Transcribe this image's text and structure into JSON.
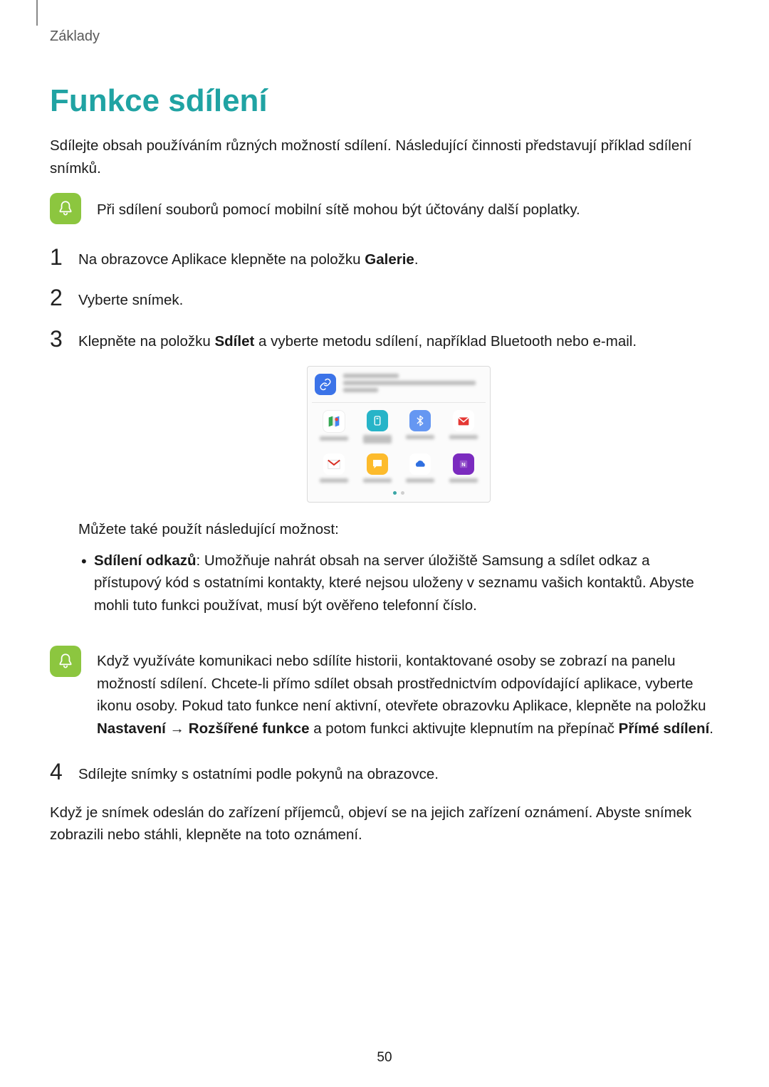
{
  "chapter": "Základy",
  "title": "Funkce sdílení",
  "intro": "Sdílejte obsah používáním různých možností sdílení. Následující činnosti představují příklad sdílení snímků.",
  "note1": "Při sdílení souborů pomocí mobilní sítě mohou být účtovány další poplatky.",
  "steps": {
    "s1_pre": "Na obrazovce Aplikace klepněte na položku ",
    "s1_bold": "Galerie",
    "s1_post": ".",
    "s2": "Vyberte snímek.",
    "s3_pre": "Klepněte na položku ",
    "s3_bold": "Sdílet",
    "s3_post": " a vyberte metodu sdílení, například Bluetooth nebo e-mail.",
    "s4": "Sdílejte snímky s ostatními podle pokynů na obrazovce."
  },
  "also_use": "Můžete také použít následující možnost:",
  "bullet": {
    "bold": "Sdílení odkazů",
    "text": ": Umožňuje nahrát obsah na server úložiště Samsung a sdílet odkaz a přístupový kód s ostatními kontakty, které nejsou uloženy v seznamu vašich kontaktů. Abyste mohli tuto funkci používat, musí být ověřeno telefonní číslo."
  },
  "note2": {
    "p1": "Když využíváte komunikaci nebo sdílíte historii, kontaktované osoby se zobrazí na panelu možností sdílení. Chcete-li přímo sdílet obsah prostřednictvím odpovídající aplikace, vyberte ikonu osoby. Pokud tato funkce není aktivní, otevřete obrazovku Aplikace, klepněte na položku ",
    "b1": "Nastavení",
    "arrow": " → ",
    "b2": "Rozšířené funkce",
    "p2": " a potom funkci aktivujte klepnutím na přepínač ",
    "b3": "Přímé sdílení",
    "p3": "."
  },
  "closing": "Když je snímek odeslán do zařízení příjemců, objeví se na jejich zařízení oznámení. Abyste snímek zobrazili nebo stáhli, klepněte na toto oznámení.",
  "page_number": "50",
  "share_panel": {
    "apps": [
      "maps",
      "android-beam",
      "bluetooth",
      "email",
      "gmail",
      "messages",
      "onedrive",
      "onenote"
    ]
  }
}
